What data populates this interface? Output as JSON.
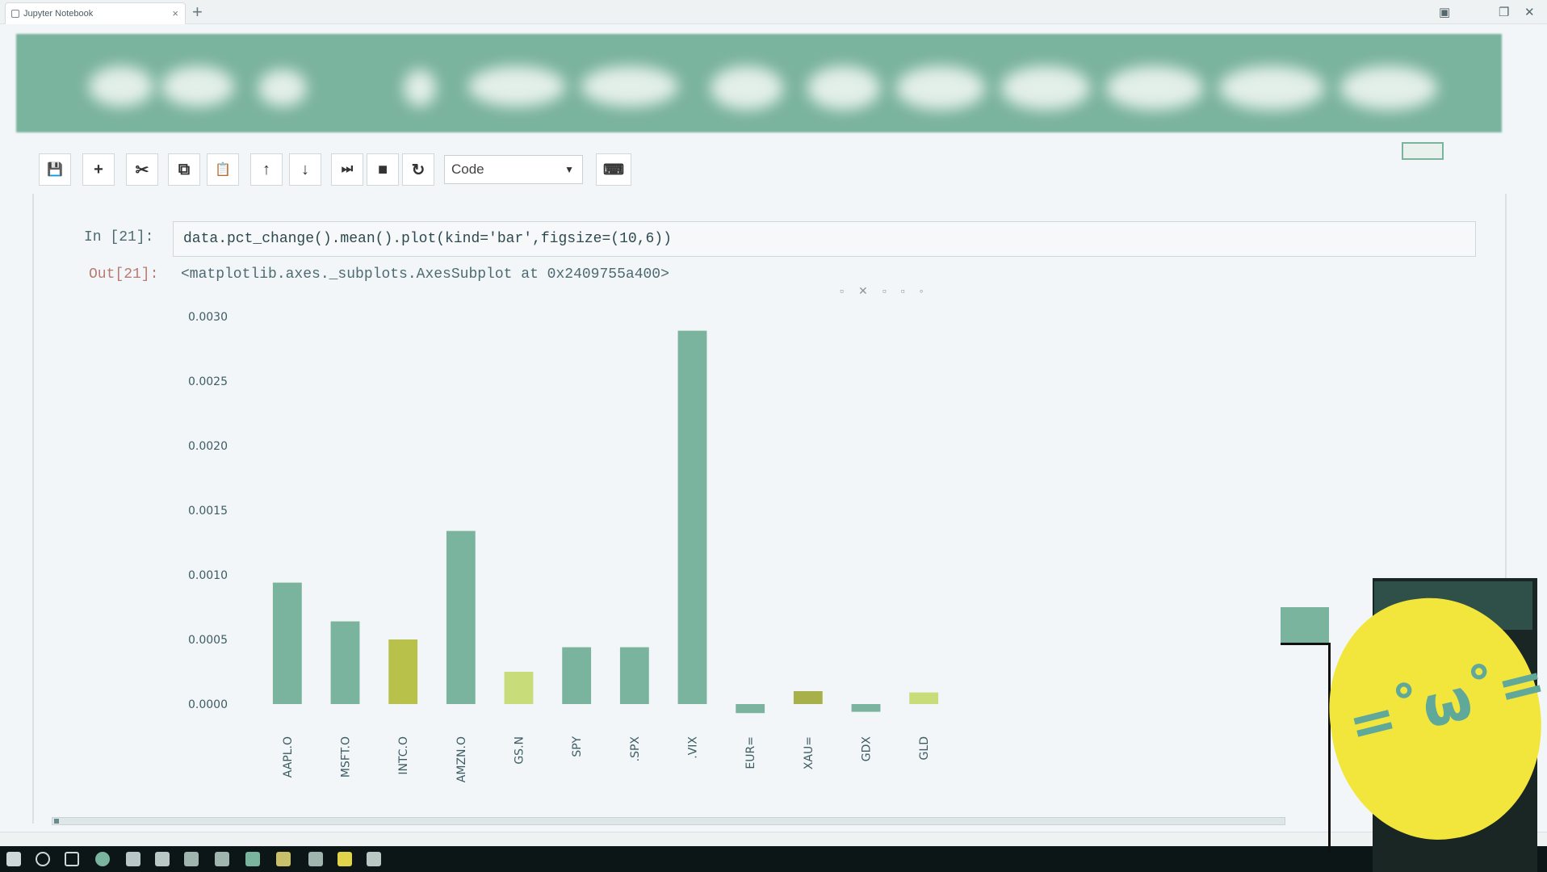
{
  "browser": {
    "tab_title": "Jupyter Notebook",
    "tab_close": "×",
    "new_tab": "+"
  },
  "toolbar": {
    "save_icon": "💾",
    "add_icon": "+",
    "cut_icon": "✂",
    "copy_icon": "⧉",
    "paste_icon": "📋",
    "move_up_icon": "↑",
    "move_down_icon": "↓",
    "run_icon": "⏭",
    "stop_icon": "■",
    "restart_icon": "↻",
    "cell_type": "Code",
    "keyboard_icon": "⌨"
  },
  "cell": {
    "in_prompt": "In [21]:",
    "code": "data.pct_change().mean().plot(kind='bar',figsize=(10,6))",
    "out_prompt": "Out[21]:",
    "output_repr": "<matplotlib.axes._subplots.AxesSubplot at 0x2409755a400>"
  },
  "chart_data": {
    "type": "bar",
    "categories": [
      "AAPL.O",
      "MSFT.O",
      "INTC.O",
      "AMZN.O",
      "GS.N",
      "SPY",
      ".SPX",
      ".VIX",
      "EUR=",
      "XAU=",
      "GDX",
      "GLD"
    ],
    "values": [
      0.00094,
      0.00064,
      0.0005,
      0.00134,
      0.00025,
      0.00044,
      0.00044,
      0.00289,
      -7e-05,
      0.0001,
      -6e-05,
      9e-05
    ],
    "bar_colors": [
      "#7ab39e",
      "#7ab39e",
      "#b8c24a",
      "#7ab39e",
      "#c8dc7a",
      "#7ab39e",
      "#7ab39e",
      "#7ab39e",
      "#7ab39e",
      "#a8b04a",
      "#7ab39e",
      "#c8dc7a"
    ],
    "yticks": [
      "0.0000",
      "0.0005",
      "0.0010",
      "0.0015",
      "0.0020",
      "0.0025",
      "0.0030"
    ],
    "ylim": [
      -0.0001,
      0.003
    ],
    "title": "",
    "xlabel": "",
    "ylabel": ""
  },
  "statusbar": {
    "left": "",
    "right": ""
  },
  "colors": {
    "accent": "#7ab39e",
    "taskbar": "#0d1616"
  }
}
